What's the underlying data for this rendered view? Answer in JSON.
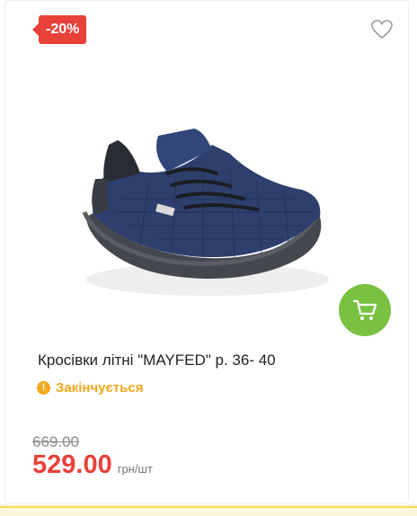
{
  "product": {
    "discount_badge": "-20%",
    "title": "Кросівки літні \"MAYFED\" р. 36- 40",
    "stock_status": "Закінчується",
    "old_price": "669.00",
    "price": "529.00",
    "unit": "грн/шт",
    "image_alt": "Navy mesh sneakers MAYFED"
  },
  "icons": {
    "wishlist": "heart-outline-icon",
    "cart": "shopping-cart-icon",
    "stock": "warning-icon"
  },
  "colors": {
    "badge": "#e8413a",
    "cart_button": "#7ac142",
    "stock_warning": "#f4a81c",
    "price": "#e8413a"
  }
}
